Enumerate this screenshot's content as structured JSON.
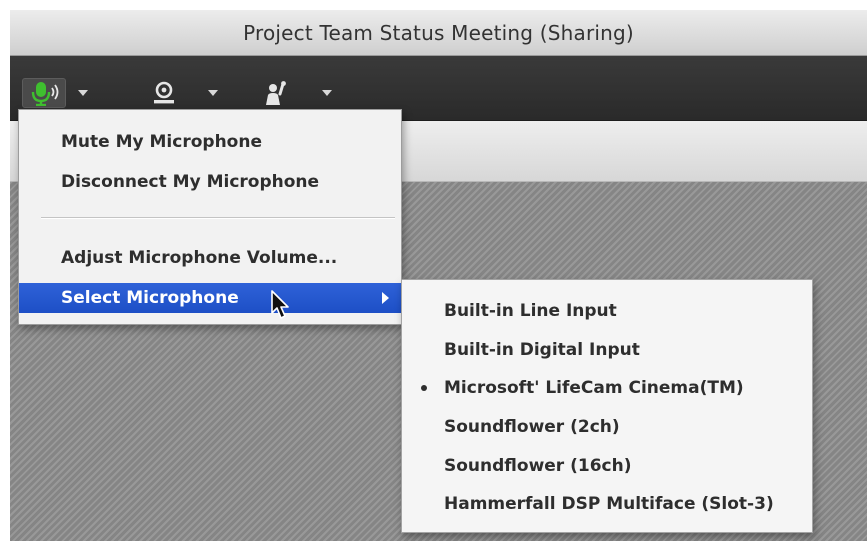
{
  "window": {
    "title": "Project Team Status Meeting (Sharing)"
  },
  "toolbar": {
    "buttons": [
      {
        "icon": "microphone-icon",
        "accent": "#3fbf2f"
      },
      {
        "icon": "webcam-icon"
      },
      {
        "icon": "raise-hand-icon"
      }
    ]
  },
  "mic_menu": {
    "items": [
      {
        "label": "Mute My Microphone"
      },
      {
        "label": "Disconnect My Microphone"
      },
      {
        "label": "Adjust Microphone Volume..."
      },
      {
        "label": "Select Microphone",
        "selected": true,
        "has_submenu": true
      }
    ]
  },
  "select_microphone": {
    "items": [
      {
        "label": "Built-in Line Input",
        "checked": false
      },
      {
        "label": "Built-in Digital Input",
        "checked": false
      },
      {
        "label": "Microsoft' LifeCam Cinema(TM)",
        "checked": true
      },
      {
        "label": "Soundflower (2ch)",
        "checked": false
      },
      {
        "label": "Soundflower (16ch)",
        "checked": false
      },
      {
        "label": "Hammerfall DSP Multiface (Slot-3)",
        "checked": false
      }
    ]
  },
  "colors": {
    "highlight": "#2458d4",
    "mic_active": "#3fbf2f"
  }
}
